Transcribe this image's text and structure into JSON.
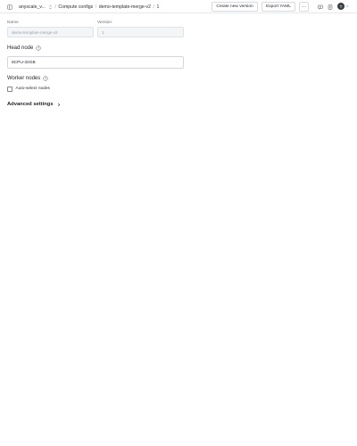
{
  "header": {
    "breadcrumbs": {
      "org": "anyscale_v...",
      "section": "Compute configs",
      "config": "demo-template-merge-v2",
      "version": "1"
    },
    "separator": "/",
    "create_version_label": "Create new version",
    "export_yaml_label": "Export YAML",
    "more_label": "···",
    "avatar_initial": "T"
  },
  "form": {
    "name_label": "Name",
    "name_value": "demo-template-merge-v2",
    "version_label": "Version",
    "version_value": "1",
    "head_node_title": "Head node",
    "head_node_value": "8CPU-32GB",
    "worker_nodes_title": "Worker nodes",
    "auto_select_label": "Auto-select nodes",
    "auto_select_checked": false,
    "advanced_settings_title": "Advanced settings"
  },
  "icons": {
    "sidebar": "sidebar-toggle-icon",
    "org_switch": "chevron-up-down-icon",
    "chat": "chat-icon",
    "docs": "docs-icon",
    "help": "help-circle-icon",
    "expand": "chevron-right-icon",
    "account_menu": "chevron-down-icon"
  }
}
